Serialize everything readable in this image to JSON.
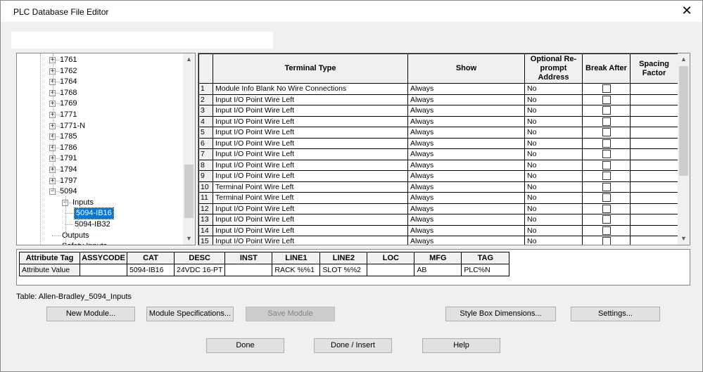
{
  "window": {
    "title": "PLC Database File Editor",
    "close_glyph": "✕"
  },
  "tree": {
    "items": [
      {
        "label": "1761",
        "expander": "+"
      },
      {
        "label": "1762",
        "expander": "+"
      },
      {
        "label": "1764",
        "expander": "+"
      },
      {
        "label": "1768",
        "expander": "+"
      },
      {
        "label": "1769",
        "expander": "+"
      },
      {
        "label": "1771",
        "expander": "+"
      },
      {
        "label": "1771-N",
        "expander": "+"
      },
      {
        "label": "1785",
        "expander": "+"
      },
      {
        "label": "1786",
        "expander": "+"
      },
      {
        "label": "1791",
        "expander": "+"
      },
      {
        "label": "1794",
        "expander": "+"
      },
      {
        "label": "1797",
        "expander": "+"
      },
      {
        "label": "5094",
        "expander": "−"
      },
      {
        "label": "Inputs",
        "expander": "−"
      },
      {
        "label": "5094-IB16",
        "expander": ""
      },
      {
        "label": "5094-IB32",
        "expander": ""
      },
      {
        "label": "Outputs",
        "expander": ""
      },
      {
        "label": "Safety Inputs",
        "expander": ""
      }
    ]
  },
  "grid": {
    "headers": [
      "",
      "Terminal Type",
      "Show",
      "Optional Re-prompt Address",
      "Break After",
      "Spacing Factor"
    ],
    "rows": [
      {
        "n": "1",
        "type": "Module Info Blank No Wire Connections",
        "show": "Always",
        "reprompt": "No"
      },
      {
        "n": "2",
        "type": "Input I/O Point Wire Left",
        "show": "Always",
        "reprompt": "No"
      },
      {
        "n": "3",
        "type": "Input I/O Point Wire Left",
        "show": "Always",
        "reprompt": "No"
      },
      {
        "n": "4",
        "type": "Input I/O Point Wire Left",
        "show": "Always",
        "reprompt": "No"
      },
      {
        "n": "5",
        "type": "Input I/O Point Wire Left",
        "show": "Always",
        "reprompt": "No"
      },
      {
        "n": "6",
        "type": "Input I/O Point Wire Left",
        "show": "Always",
        "reprompt": "No"
      },
      {
        "n": "7",
        "type": "Input I/O Point Wire Left",
        "show": "Always",
        "reprompt": "No"
      },
      {
        "n": "8",
        "type": "Input I/O Point Wire Left",
        "show": "Always",
        "reprompt": "No"
      },
      {
        "n": "9",
        "type": "Input I/O Point Wire Left",
        "show": "Always",
        "reprompt": "No"
      },
      {
        "n": "10",
        "type": "Terminal Point Wire Left",
        "show": "Always",
        "reprompt": "No"
      },
      {
        "n": "11",
        "type": "Terminal Point Wire Left",
        "show": "Always",
        "reprompt": "No"
      },
      {
        "n": "12",
        "type": "Input I/O Point Wire Left",
        "show": "Always",
        "reprompt": "No"
      },
      {
        "n": "13",
        "type": "Input I/O Point Wire Left",
        "show": "Always",
        "reprompt": "No"
      },
      {
        "n": "14",
        "type": "Input I/O Point Wire Left",
        "show": "Always",
        "reprompt": "No"
      },
      {
        "n": "15",
        "type": "Input I/O Point Wire Left",
        "show": "Always",
        "reprompt": "No"
      }
    ]
  },
  "attributes": {
    "headers": [
      "Attribute Tag",
      "ASSYCODE",
      "CAT",
      "DESC",
      "INST",
      "LINE1",
      "LINE2",
      "LOC",
      "MFG",
      "TAG"
    ],
    "values": [
      "Attribute Value",
      "",
      "5094-IB16",
      "24VDC 16-PT",
      "",
      "RACK %%1",
      "SLOT %%2",
      "",
      "AB",
      "PLC%N"
    ]
  },
  "table_name": "Table: Allen-Bradley_5094_Inputs",
  "buttons": {
    "new_module": "New Module...",
    "module_specs": "Module Specifications...",
    "save_module": "Save Module",
    "style_box": "Style Box Dimensions...",
    "settings": "Settings...",
    "done": "Done",
    "done_insert": "Done / Insert",
    "help": "Help"
  }
}
